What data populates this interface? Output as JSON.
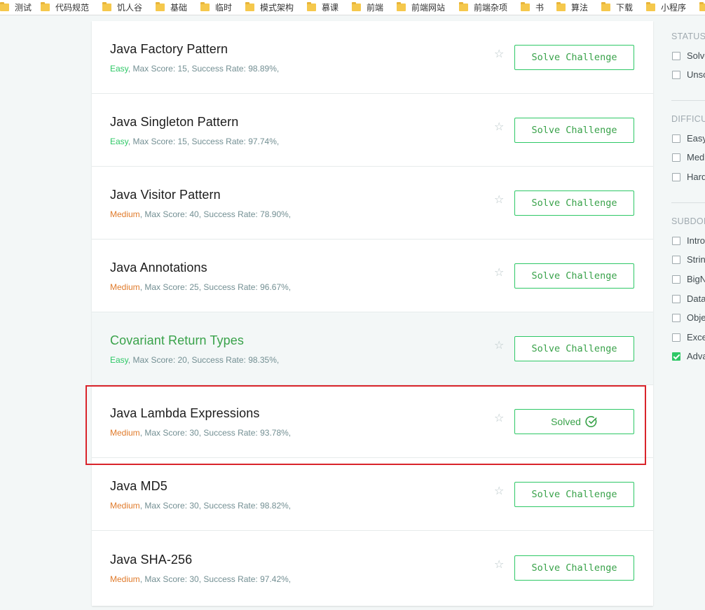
{
  "bookmarks": [
    "测试",
    "代码规范",
    "饥人谷",
    "基础",
    "临时",
    "模式架构",
    "慕课",
    "前端",
    "前端网站",
    "前端杂项",
    "书",
    "算法",
    "下载",
    "小程序"
  ],
  "colors": {
    "accent_green": "#2ec866",
    "medium_orange": "#e07b2c",
    "highlight_red": "#d9242b"
  },
  "challenges": [
    {
      "title": "Java Factory Pattern",
      "difficulty": "Easy",
      "meta": ", Max Score: 15, Success Rate: 98.89%,",
      "button": "Solve Challenge"
    },
    {
      "title": "Java Singleton Pattern",
      "difficulty": "Easy",
      "meta": ", Max Score: 15, Success Rate: 97.74%,",
      "button": "Solve Challenge"
    },
    {
      "title": "Java Visitor Pattern",
      "difficulty": "Medium",
      "meta": ", Max Score: 40, Success Rate: 78.90%,",
      "button": "Solve Challenge"
    },
    {
      "title": "Java Annotations",
      "difficulty": "Medium",
      "meta": ", Max Score: 25, Success Rate: 96.67%,",
      "button": "Solve Challenge"
    },
    {
      "title": "Covariant Return Types",
      "difficulty": "Easy",
      "meta": ", Max Score: 20, Success Rate: 98.35%,",
      "button": "Solve Challenge"
    },
    {
      "title": "Java Lambda Expressions",
      "difficulty": "Medium",
      "meta": ", Max Score: 30, Success Rate: 93.78%,",
      "button": "Solved"
    },
    {
      "title": "Java MD5",
      "difficulty": "Medium",
      "meta": ", Max Score: 30, Success Rate: 98.82%,",
      "button": "Solve Challenge"
    },
    {
      "title": "Java SHA-256",
      "difficulty": "Medium",
      "meta": ", Max Score: 30, Success Rate: 97.42%,",
      "button": "Solve Challenge"
    }
  ],
  "sidebar": {
    "status_title": "STATUS",
    "status_options": [
      "Solve",
      "Unso"
    ],
    "difficulty_title": "DIFFICU",
    "difficulty_options": [
      "Easy",
      "Med",
      "Hard"
    ],
    "subdomain_title": "SUBDOM",
    "subdomain_options": [
      "Intro",
      "Strin",
      "BigN",
      "Data",
      "Obje",
      "Exce",
      "Adva"
    ],
    "subdomain_checked": "Adva"
  }
}
